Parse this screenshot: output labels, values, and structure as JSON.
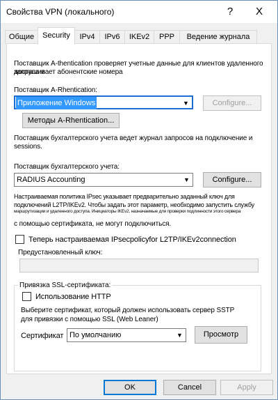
{
  "window": {
    "title": "Свойства VPN (локального)",
    "help_icon": "?",
    "close_icon": "X"
  },
  "tabs": [
    {
      "label": "Общие"
    },
    {
      "label": "Security",
      "active": true
    },
    {
      "label": "IPv4"
    },
    {
      "label": "IPv6"
    },
    {
      "label": "IKEv2"
    },
    {
      "label": "PPP"
    },
    {
      "label": "Ведение журнала"
    }
  ],
  "auth": {
    "description_line1": "Поставщик A-thentication проверяет учетные данные для клиентов удаленного доступа и",
    "description_line2": "запрашивает абонентские номера",
    "provider_label": "Поставщик A-Rhentication:",
    "provider_value": "Приложение Windows",
    "configure_label": "Configure...",
    "methods_label": "Методы A-Rhentication..."
  },
  "accounting": {
    "description_line1": "Поставщик бухгалтерского учета ведет журнал запросов на подключение и",
    "description_line2": "sessions.",
    "provider_label": "Поставщик бухгалтерского учета:",
    "provider_value": "RADIUS Accounting",
    "configure_label": "Configure..."
  },
  "ipsec": {
    "line1": "Настраиваемая политика IPsec указывает предварительно заданный ключ для",
    "line2": "подключений L2TP/IKEv2. Чтобы задать этот параметр, необходимо запустить службу",
    "line3": "маршрутизации и удаленного доступа. Инициаторы IKEv2, назначаемые для проверки подлинности этого сервера",
    "line4": "с помощью сертификата, не могут подключиться.",
    "checkbox_label": "Теперь настраиваемая IPsecpolicyfor L2TP/IKEv2connection",
    "checkbox_checked": false,
    "preshared_label": "Предустановленный ключ:",
    "preshared_value": ""
  },
  "ssl": {
    "group_title": "Привязка SSL-сертификата:",
    "http_label": "Использование HTTP",
    "http_checked": false,
    "description_line1": "Выберите сертификат, который должен использовать сервер SSTP",
    "description_line2": "для привязки с помощью SSL (Web Leaner)",
    "cert_label": "Сертификат",
    "cert_value": "По умолчанию",
    "view_label": "Просмотр"
  },
  "footer": {
    "ok_label": "OK",
    "cancel_label": "Cancel",
    "apply_label": "Apply"
  }
}
